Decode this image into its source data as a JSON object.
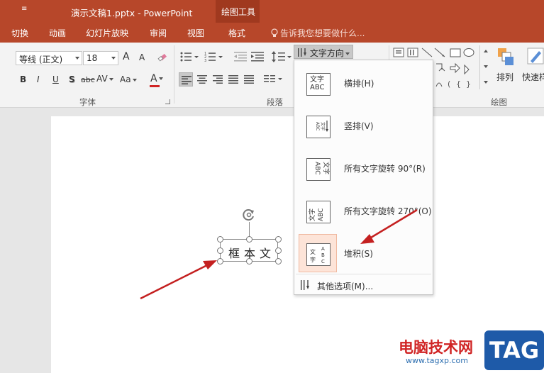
{
  "titlebar": {
    "quick_access": "≡",
    "title": "演示文稿1.pptx - PowerPoint",
    "context_group": "绘图工具"
  },
  "tabs": [
    {
      "label": "切换"
    },
    {
      "label": "动画"
    },
    {
      "label": "幻灯片放映"
    },
    {
      "label": "审阅"
    },
    {
      "label": "视图"
    },
    {
      "label": "格式"
    }
  ],
  "tell_me": "告诉我您想要做什么...",
  "ribbon": {
    "font_name": "等线 (正文)",
    "font_size": "18",
    "grow_font": "A",
    "shrink_font": "A",
    "bold": "B",
    "italic": "I",
    "underline": "U",
    "shadow": "S",
    "strike": "abc",
    "spacing": "AV",
    "change_case": "Aa",
    "font_color": "A",
    "font_group": "字体",
    "paragraph_group": "段落",
    "drawing_group": "绘图",
    "text_direction": "文字方向",
    "arrange": "排列",
    "quick_styles": "快速样"
  },
  "colors": {
    "accent": "#b7472a",
    "font_color_bar": "#d02424"
  },
  "textbox": {
    "text": "框本文"
  },
  "menu": {
    "items": [
      {
        "label": "横排(H)",
        "preview": "文字\nABC"
      },
      {
        "label": "竖排(V)",
        "preview": "vertical"
      },
      {
        "label": "所有文字旋转 90°(R)",
        "preview": "rot90"
      },
      {
        "label": "所有文字旋转 270°(O)",
        "preview": "rot270"
      },
      {
        "label": "堆积(S)",
        "preview": "stacked"
      }
    ],
    "more": "其他选项(M)..."
  },
  "watermark": {
    "site_name": "电脑技术网",
    "url": "www.tagxp.com",
    "logo": "TAG"
  }
}
